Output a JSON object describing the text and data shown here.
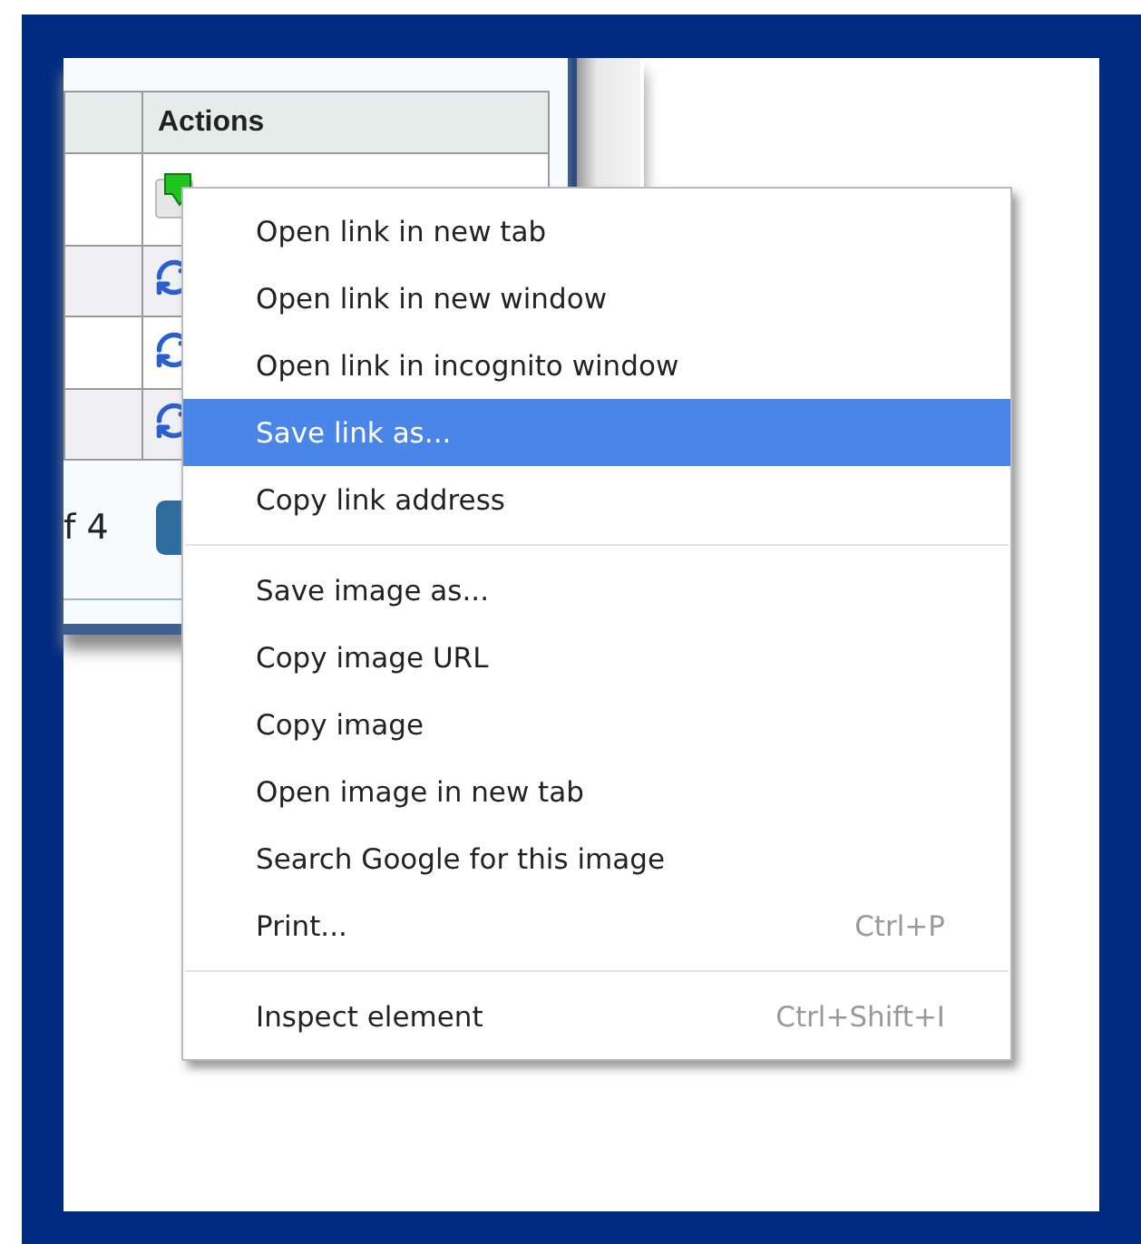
{
  "table": {
    "columns": [
      "Actions"
    ],
    "rows": [
      {
        "kind": "download"
      },
      {
        "kind": "refresh"
      },
      {
        "kind": "refresh"
      },
      {
        "kind": "refresh"
      }
    ]
  },
  "pager": {
    "text": "f 4"
  },
  "context_menu": {
    "groups": [
      {
        "items": [
          {
            "label": "Open link in new tab",
            "selected": false
          },
          {
            "label": "Open link in new window",
            "selected": false
          },
          {
            "label": "Open link in incognito window",
            "selected": false
          },
          {
            "label": "Save link as...",
            "selected": true
          },
          {
            "label": "Copy link address",
            "selected": false
          }
        ]
      },
      {
        "items": [
          {
            "label": "Save image as...",
            "selected": false
          },
          {
            "label": "Copy image URL",
            "selected": false
          },
          {
            "label": "Copy image",
            "selected": false
          },
          {
            "label": "Open image in new tab",
            "selected": false
          },
          {
            "label": "Search Google for this image",
            "selected": false
          },
          {
            "label": "Print...",
            "shortcut": "Ctrl+P",
            "selected": false
          }
        ]
      },
      {
        "items": [
          {
            "label": "Inspect element",
            "shortcut": "Ctrl+Shift+I",
            "selected": false
          }
        ]
      }
    ]
  }
}
